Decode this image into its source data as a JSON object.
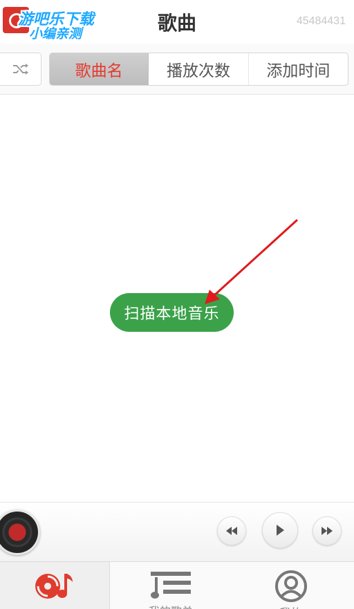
{
  "header": {
    "title": "歌曲",
    "user_id": "45484431",
    "watermark_line1": "游吧乐下载",
    "watermark_line2": "小编亲测"
  },
  "sort_tabs": [
    {
      "label": "歌曲名",
      "selected": true
    },
    {
      "label": "播放次数",
      "selected": false
    },
    {
      "label": "添加时间",
      "selected": false
    }
  ],
  "shuffle_icon": "shuffle-icon",
  "scan_button": {
    "label": "扫描本地音乐"
  },
  "player": {
    "controls": [
      "rewind-icon",
      "play-icon",
      "fast-forward-icon"
    ]
  },
  "nav": {
    "items": [
      {
        "icon": "music-disc-icon",
        "label": "",
        "active": true
      },
      {
        "icon": "playlist-icon",
        "label": "我的歌单",
        "active": false
      },
      {
        "icon": "user-icon",
        "label": "我的",
        "active": false
      }
    ]
  },
  "colors": {
    "accent_red": "#e33a2e",
    "scan_green": "#3ba24a",
    "arrow_red": "#e01b1b"
  }
}
